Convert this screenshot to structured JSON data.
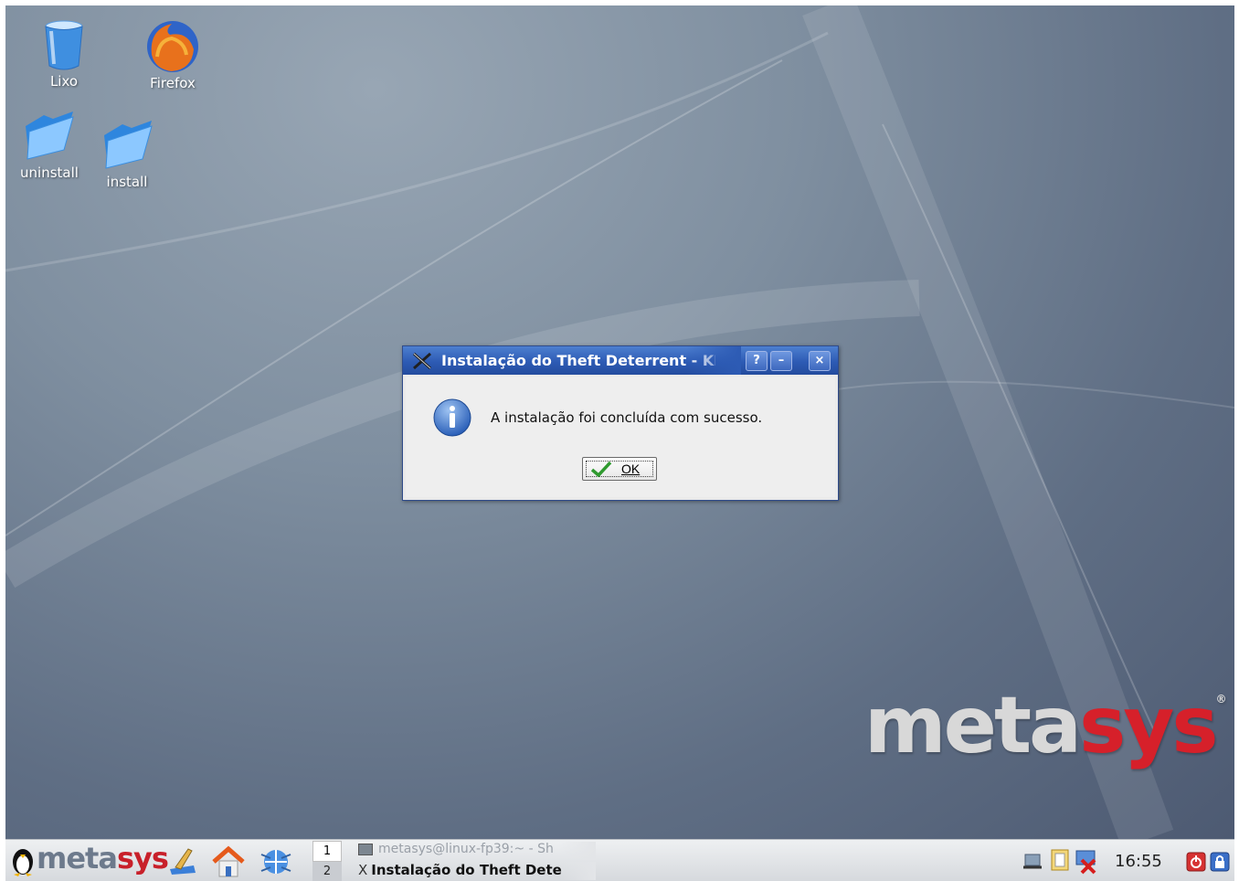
{
  "desktop": {
    "icons": [
      {
        "name": "trash",
        "label": "Lixo"
      },
      {
        "name": "firefox",
        "label": "Firefox"
      },
      {
        "name": "uninstall",
        "label": "uninstall"
      },
      {
        "name": "install",
        "label": "install"
      }
    ],
    "brand": {
      "text_main": "meta",
      "text_accent": "sys",
      "mark": "®"
    }
  },
  "dialog": {
    "title": "Instalação do Theft Deterrent - KD",
    "buttons": {
      "help": "?",
      "minimize": "–",
      "close": "×"
    },
    "message": "A instalação foi concluída com sucesso.",
    "ok_label": "OK",
    "icon": "info-icon"
  },
  "taskbar": {
    "logo_main": "meta",
    "logo_accent": "sys",
    "pager": [
      "1",
      "2"
    ],
    "tasks": [
      {
        "label": "metasys@linux-fp39:~ - Sh",
        "active": false
      },
      {
        "label": "Instalação do Theft Dete",
        "active": true
      }
    ],
    "clock": "16:55"
  },
  "colors": {
    "accent": "#2d5bb4",
    "brand_red": "#d6202a"
  }
}
